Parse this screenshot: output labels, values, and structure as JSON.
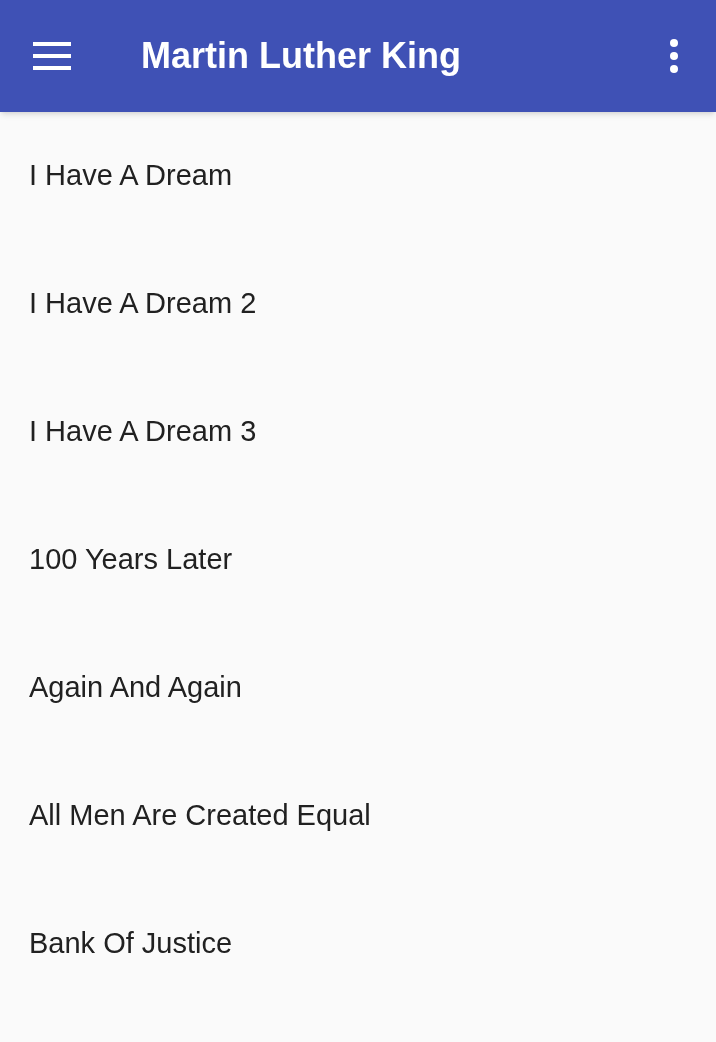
{
  "app_bar": {
    "title": "Martin Luther King"
  },
  "list": [
    {
      "label": "I Have A Dream"
    },
    {
      "label": "I Have A Dream 2"
    },
    {
      "label": "I Have A Dream 3"
    },
    {
      "label": "100 Years Later"
    },
    {
      "label": "Again And Again"
    },
    {
      "label": "All Men Are Created Equal"
    },
    {
      "label": "Bank Of Justice"
    }
  ]
}
